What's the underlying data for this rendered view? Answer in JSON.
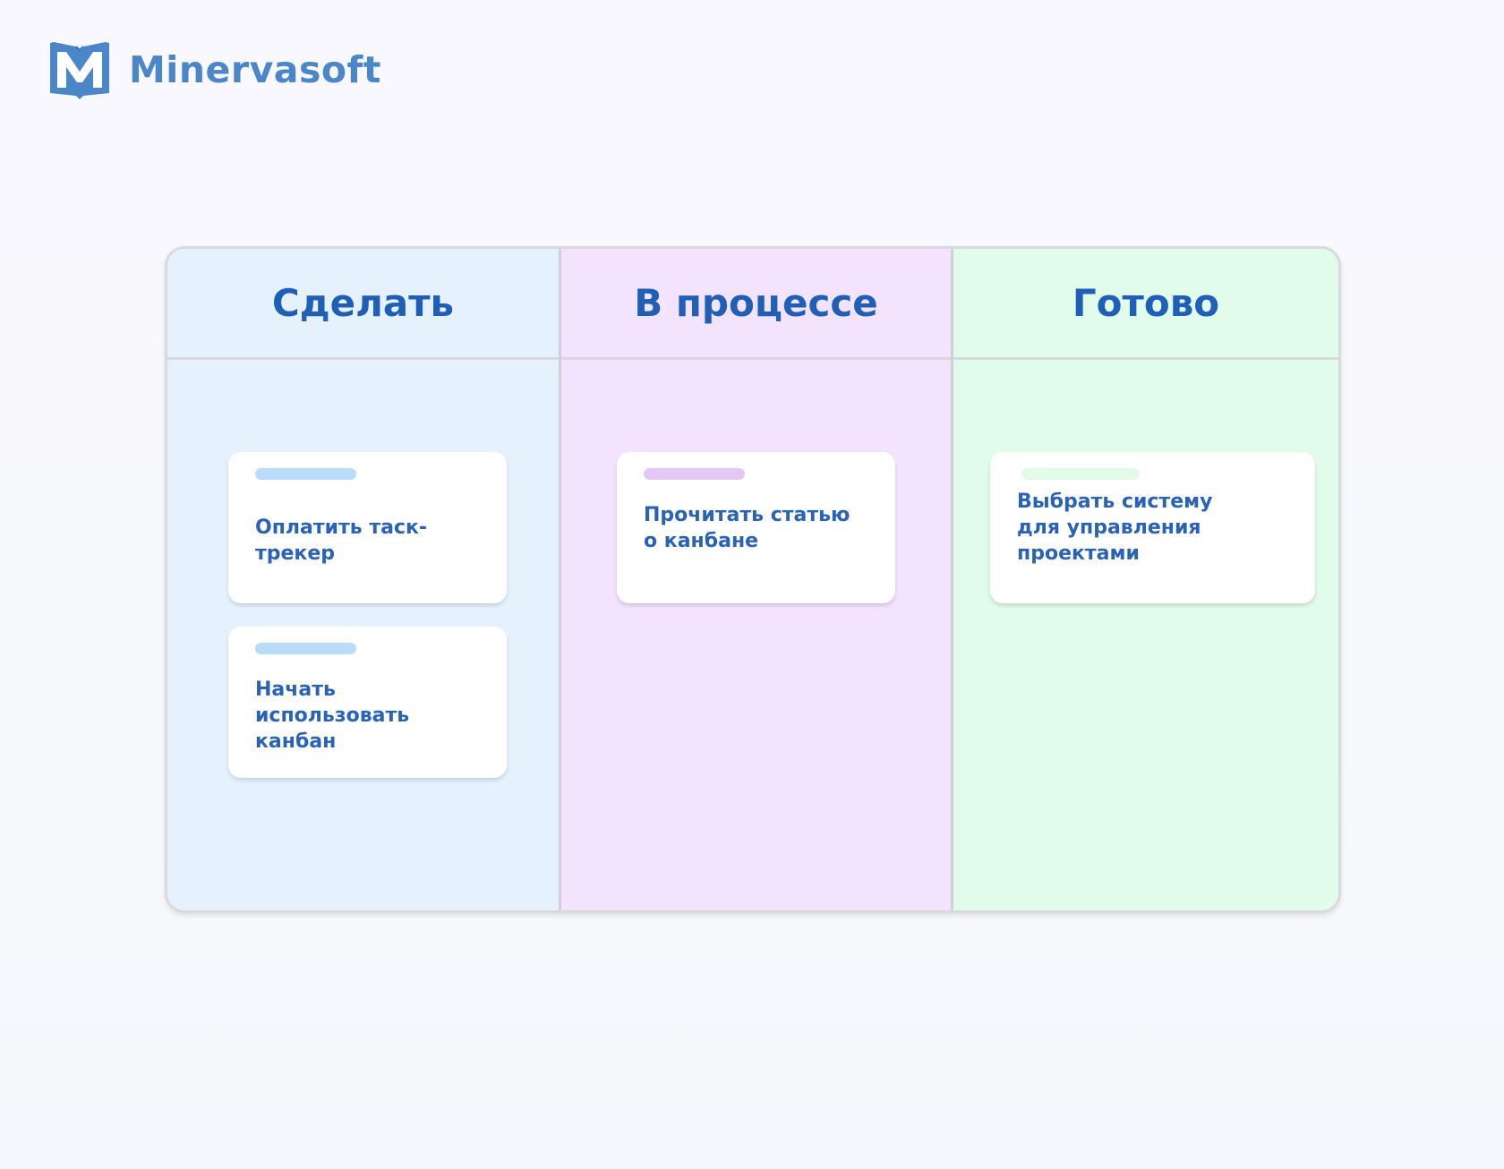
{
  "brand": {
    "name": "Minervasoft",
    "logo_icon": "book-m-logo-icon",
    "color": "#4a86c8"
  },
  "board": {
    "columns": [
      {
        "title": "Сделать",
        "background": "#e5f2fe",
        "tag_color": "#b9dcfb",
        "cards": [
          {
            "text": "Оплатить таск-трекер"
          },
          {
            "text": "Начать\nиспользовать канбан"
          }
        ]
      },
      {
        "title": "В процессе",
        "background": "#f3e3fd",
        "tag_color": "#e3c7f4",
        "cards": [
          {
            "text": "Прочитать статью\nо канбане"
          }
        ]
      },
      {
        "title": "Готово",
        "background": "#e1fcea",
        "tag_color": "#e2fbe9",
        "cards": [
          {
            "text": "Выбрать систему\nдля управления\nпроектами"
          }
        ]
      }
    ]
  },
  "colors": {
    "title_text": "#1f5fb7",
    "card_text": "#2a63b4",
    "border": "#d9d9de"
  }
}
